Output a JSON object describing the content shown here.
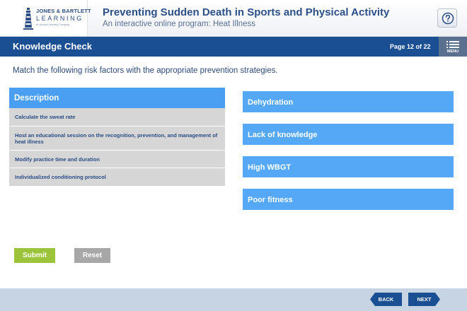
{
  "header": {
    "logo_line1": "JONES & BARTLETT",
    "logo_line2": "LEARNING",
    "logo_line3": "An Ascend Learning Company",
    "course_title": "Preventing Sudden Death in Sports and Physical Activity",
    "course_subtitle": "An interactive online program: Heat Illness",
    "help_icon": "question-icon"
  },
  "titlebar": {
    "section_title": "Knowledge Check",
    "page_indicator": "Page 12 of 22",
    "menu_label": "MENU",
    "menu_icon": "menu-list-icon"
  },
  "activity": {
    "instruction": "Match the following risk factors with the appropriate prevention strategies.",
    "description_header": "Description",
    "descriptions": [
      "Calculate the sweat rate",
      "Host an educational session on the recognition, prevention, and management of heat illness",
      "Modify practice time and duration",
      "Individualized conditioning protocol"
    ],
    "targets": [
      "Dehydration",
      "Lack of knowledge",
      "High WBGT",
      "Poor fitness"
    ],
    "submit_label": "Submit",
    "reset_label": "Reset"
  },
  "footer": {
    "back_label": "BACK",
    "next_label": "NEXT"
  },
  "colors": {
    "brand_navy": "#1a4f94",
    "accent_blue": "#4a9ff2",
    "submit_green": "#9bc43a",
    "reset_gray": "#a7a7a7",
    "footer_bg": "#c7d4e4"
  }
}
